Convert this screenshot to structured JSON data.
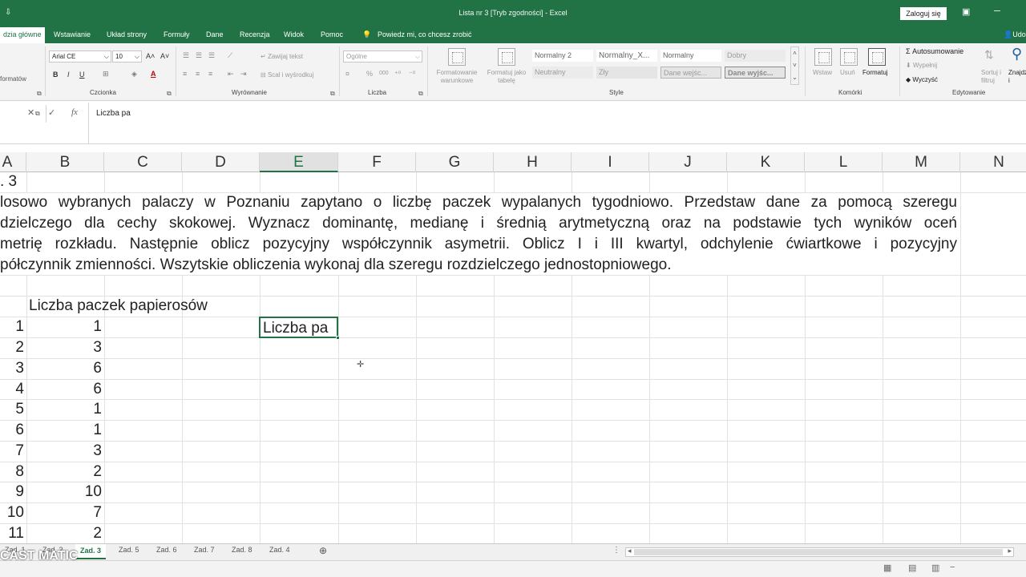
{
  "titlebar": {
    "title": "Lista nr 3  [Tryb zgodności]  -  Excel",
    "login": "Zaloguj się"
  },
  "ribbon_tabs": [
    "dzia główne",
    "Wstawianie",
    "Układ strony",
    "Formuły",
    "Dane",
    "Recenzja",
    "Widok",
    "Pomoc",
    "Powiedz mi, co chcesz zrobić",
    "Udo"
  ],
  "ribbon": {
    "clipboard": {
      "format_label": "formatów"
    },
    "font": {
      "name": "Arial CE",
      "size": "10",
      "label": "Czcionka",
      "bold": "B",
      "italic": "I",
      "underline": "U",
      "grow": "A˄",
      "shrink": "A˅",
      "color": "A"
    },
    "alignment": {
      "wrap": "Zawijaj tekst",
      "merge": "Scal i wyśrodkuj",
      "label": "Wyrównanie"
    },
    "number": {
      "format": "Ogólne",
      "percent": "%",
      "thousands": "000",
      "label": "Liczba"
    },
    "styles": {
      "cond_format": "Formatowanie warunkowe",
      "table_format": "Formatuj jako tabelę",
      "cells": [
        "Normalny 2",
        "Normalny_X...",
        "Normalny",
        "Dobry",
        "Neutralny",
        "Zły",
        "Dane wejśc...",
        "Dane wyjśc..."
      ],
      "label": "Style"
    },
    "cells": {
      "insert": "Wstaw",
      "delete": "Usuń",
      "format": "Formatuj",
      "label": "Komórki"
    },
    "editing": {
      "autosum": "Autosumowanie",
      "fill": "Wypełnij",
      "clear": "Wyczyść",
      "sort": "Sortuj i filtruj",
      "find": "Znajdź i zaznacz",
      "label": "Edytowanie"
    }
  },
  "formula_bar": {
    "content": "Liczba pa",
    "fx": "fx",
    "cancel": "✕",
    "enter": "✓"
  },
  "columns": [
    "A",
    "B",
    "C",
    "D",
    "E",
    "F",
    "G",
    "H",
    "I",
    "J",
    "K",
    "L",
    "M",
    "N"
  ],
  "selected_column": "E",
  "sheet": {
    "title_cell": ". 3",
    "paragraph": [
      "losowo wybranych palaczy w Poznaniu zapytano o liczbę paczek wypalanych tygodniowo. Przedstaw dane za pomocą szeregu",
      "dzielczego dla cechy skokowej. Wyznacz dominantę, medianę i średnią arytmetyczną oraz na podstawie tych wyników oceń",
      "metrię rozkładu. Następnie oblicz pozycyjny współczynnik asymetrii. Oblicz I i III kwartyl, odchylenie ćwiartkowe i pozycyjny",
      "półczynnik zmienności. Wszytskie obliczenia wykonaj dla szeregu rozdzielczego jednostopniowego."
    ],
    "header_b": "Liczba paczek papierosów",
    "row_a": [
      "1",
      "2",
      "3",
      "4",
      "5",
      "6",
      "7",
      "8",
      "9",
      "10",
      "11"
    ],
    "row_b": [
      "1",
      "3",
      "6",
      "6",
      "1",
      "1",
      "3",
      "2",
      "10",
      "7",
      "2"
    ],
    "active_cell_text": "Liczba pa"
  },
  "sheet_tabs": [
    "Zad. 1",
    "Zad. 2",
    "Zad. 3",
    "Zad. 5",
    "Zad. 6",
    "Zad. 7",
    "Zad. 8",
    "Zad. 4"
  ],
  "active_sheet": "Zad. 3",
  "watermark": "CAST MATIC"
}
